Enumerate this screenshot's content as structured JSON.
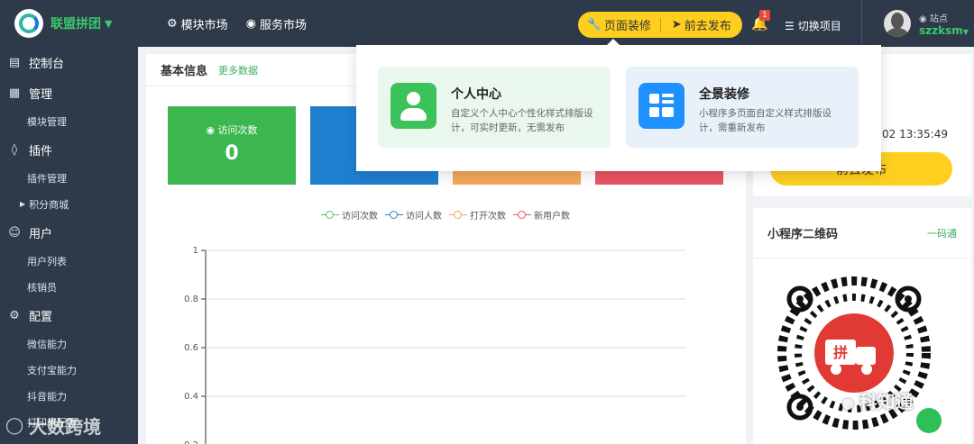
{
  "header": {
    "brand": "联盟拼团",
    "nav": [
      {
        "label": "模块市场",
        "icon": "cubes-icon"
      },
      {
        "label": "服务市场",
        "icon": "globe-icon"
      }
    ],
    "actions": {
      "decorate": "页面装修",
      "publish": "前去发布"
    },
    "notification_count": "1",
    "switch_project": "切换项目",
    "user": {
      "site_label": "站点",
      "username": "szzksm"
    }
  },
  "sidebar": {
    "groups": [
      {
        "label": "控制台",
        "icon": "dashboard-icon",
        "items": []
      },
      {
        "label": "管理",
        "icon": "grid-icon",
        "items": [
          "模块管理"
        ]
      },
      {
        "label": "插件",
        "icon": "cube-icon",
        "items": [
          "插件管理",
          "积分商城"
        ]
      },
      {
        "label": "用户",
        "icon": "user-icon",
        "items": [
          "用户列表",
          "核销员"
        ]
      },
      {
        "label": "配置",
        "icon": "gear-icon",
        "items": [
          "微信能力",
          "支付宝能力",
          "抖音能力",
          "打印机配置"
        ]
      }
    ]
  },
  "main": {
    "title": "基本信息",
    "more_link": "更多数据",
    "stats": [
      {
        "label": "访问次数",
        "value": "0",
        "color": "#3cb64f"
      },
      {
        "label": "",
        "value": "",
        "color": "#1f7fcf"
      },
      {
        "label": "",
        "value": "",
        "color": "#f5a85b"
      },
      {
        "label": "",
        "value": "",
        "color": "#ea5464"
      }
    ]
  },
  "chart_data": {
    "type": "line",
    "series": [
      {
        "name": "访问次数",
        "color": "#59c35e",
        "values": []
      },
      {
        "name": "访问人数",
        "color": "#2a7fc8",
        "values": []
      },
      {
        "name": "打开次数",
        "color": "#f3a64f",
        "values": []
      },
      {
        "name": "新用户数",
        "color": "#e4546a",
        "values": []
      }
    ],
    "yticks": [
      "1",
      "0.8",
      "0.6",
      "0.4",
      "0.2"
    ],
    "ylim": [
      0,
      1
    ],
    "grid": true,
    "legend": "top-center"
  },
  "right": {
    "time": "02 13:35:49",
    "publish_btn": "前去发布",
    "qr_title": "小程序二维码",
    "qr_link": "一码通"
  },
  "popup": {
    "options": [
      {
        "title": "个人中心",
        "desc": "自定义个人中心个性化样式排版设计，可实时更新，无需发布",
        "bg": "#e9f7ec",
        "icon_color": "#3cc25a"
      },
      {
        "title": "全景装修",
        "desc": "小程序多页面自定义样式排版设计，需重新发布",
        "bg": "#e8f0fa",
        "icon_color": "#1e90ff"
      }
    ]
  },
  "watermarks": {
    "left": "大数跨境",
    "right": "科知通"
  }
}
